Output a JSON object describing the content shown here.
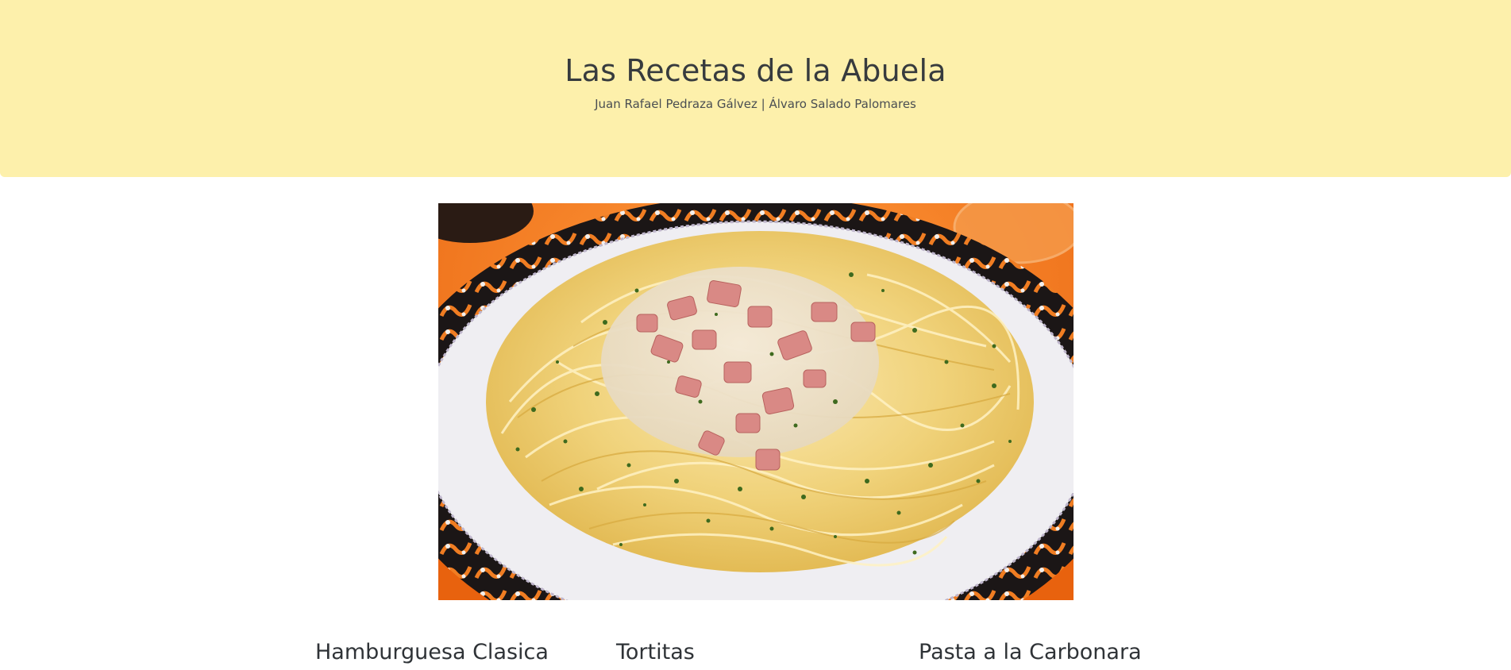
{
  "header": {
    "title": "Las Recetas de la Abuela",
    "authors": "Juan Rafael Pedraza Gálvez | Álvaro Salado Palomares",
    "background_color": "#fdf0ab"
  },
  "hero_image": {
    "subject": "plate of pasta carbonara",
    "colors": {
      "tablecloth": "#f47a1f",
      "plate": "#efeef2",
      "pasta": "#f1d57e",
      "bacon": "#d98a86",
      "parsley": "#3e6a1e"
    }
  },
  "recipes": [
    {
      "title": "Hamburguesa Clasica"
    },
    {
      "title": "Tortitas"
    },
    {
      "title": "Pasta a la Carbonara"
    }
  ]
}
